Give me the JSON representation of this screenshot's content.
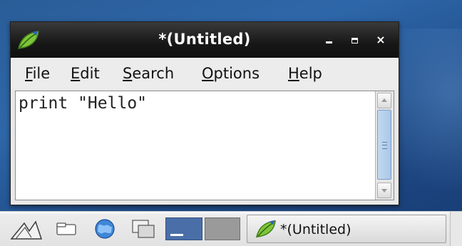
{
  "window": {
    "title": "*(Untitled)",
    "app_icon": "leafpad-icon",
    "controls": {
      "minimize": "minimize-icon",
      "maximize": "maximize-icon",
      "close": "×"
    }
  },
  "menubar": {
    "items": [
      {
        "mnemonic": "F",
        "rest": "ile"
      },
      {
        "mnemonic": "E",
        "rest": "dit"
      },
      {
        "mnemonic": "S",
        "rest": "earch"
      },
      {
        "mnemonic": "O",
        "rest": "ptions"
      },
      {
        "mnemonic": "H",
        "rest": "elp"
      }
    ]
  },
  "editor": {
    "content": "print \"Hello\""
  },
  "taskbar": {
    "launchers": [
      "start-menu-icon",
      "file-manager-icon",
      "web-browser-icon",
      "show-desktop-icon"
    ],
    "workspaces": [
      "workspace-1",
      "workspace-2"
    ],
    "tasks": [
      {
        "label": "*(Untitled)",
        "icon": "leafpad-icon"
      }
    ]
  },
  "colors": {
    "desktop": "#2e67a9",
    "titlebar": "#171717",
    "workspace_active": "#4a6fa8",
    "scroll_thumb": "#a9c7e8"
  }
}
